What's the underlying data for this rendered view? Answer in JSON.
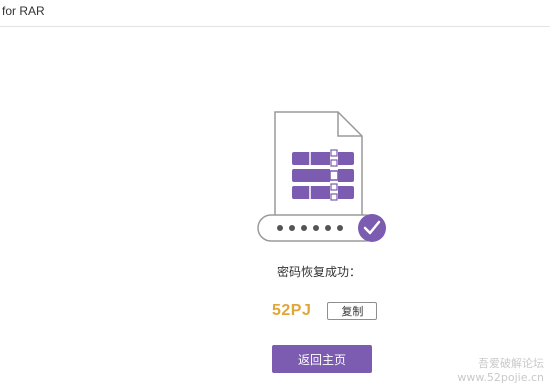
{
  "window": {
    "title": "for RAR"
  },
  "illustration": {
    "file_icon": "rar-archive-file-icon",
    "dots": "••••••",
    "check_icon": "checkmark-icon",
    "colors": {
      "accent": "#7b5cb0",
      "outline": "#9a9a9a"
    }
  },
  "result": {
    "message": "密码恢复成功：",
    "password": "52PJ",
    "copy_label": "复制"
  },
  "actions": {
    "home_label": "返回主页"
  },
  "watermark": {
    "line1": "吾爱破解论坛",
    "line2": "www.52pojie.cn"
  },
  "colors": {
    "accent": "#7b5cb0",
    "password": "#e0a63a"
  }
}
